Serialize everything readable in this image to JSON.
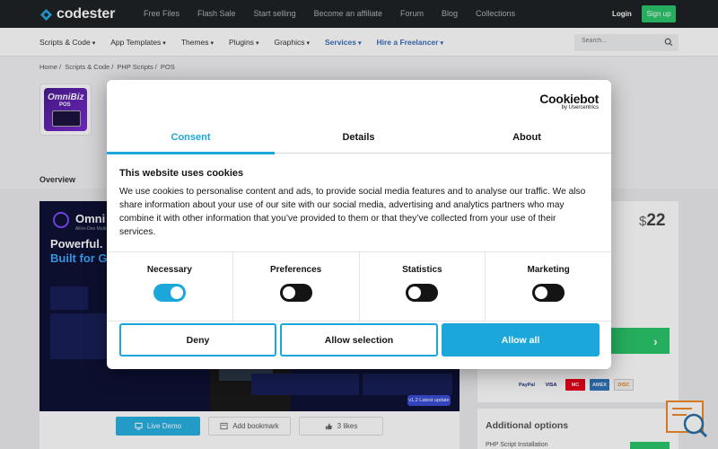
{
  "header": {
    "logo_text": "codester",
    "nav": [
      "Free Files",
      "Flash Sale",
      "Start selling",
      "Become an affiliate",
      "Forum",
      "Blog",
      "Collections"
    ],
    "login": "Login",
    "signup": "Sign up"
  },
  "categories": [
    {
      "label": "Scripts & Code",
      "style": "normal"
    },
    {
      "label": "App Templates",
      "style": "normal"
    },
    {
      "label": "Themes",
      "style": "normal"
    },
    {
      "label": "Plugins",
      "style": "normal"
    },
    {
      "label": "Graphics",
      "style": "normal"
    },
    {
      "label": "Services",
      "style": "blue"
    },
    {
      "label": "Hire a Freelancer",
      "style": "blue"
    }
  ],
  "search": {
    "placeholder": "Search..."
  },
  "breadcrumb": [
    "Home",
    "Scripts & Code",
    "PHP Scripts",
    "POS"
  ],
  "product": {
    "icon_text_1": "OmniBiz",
    "icon_text_2": "POS",
    "tab": "Overview",
    "promo": {
      "name": "Omni",
      "subtitle": "All-in-One Multi-B",
      "headline_1": "Powerful. M",
      "headline_2": "Built for G",
      "version_badge": "v1.2 Latest update"
    },
    "actions": {
      "live_demo": "Live Demo",
      "bookmark": "Add bookmark",
      "likes": "3 likes"
    }
  },
  "sidebar": {
    "currency": "$",
    "price": "22",
    "payments": [
      "PayPal",
      "VISA",
      "MC",
      "AMEX",
      "DISC"
    ],
    "additional_title": "Additional options",
    "additional_row": "PHP Script Installation"
  },
  "cookie": {
    "brand": "Cookiebot",
    "brand_sub": "by Usercentrics",
    "tabs": [
      "Consent",
      "Details",
      "About"
    ],
    "title": "This website uses cookies",
    "text": "We use cookies to personalise content and ads, to provide social media features and to analyse our traffic. We also share information about your use of our site with our social media, advertising and analytics partners who may combine it with other information that you’ve provided to them or that they’ve collected from your use of their services.",
    "toggles": [
      {
        "label": "Necessary",
        "on": true
      },
      {
        "label": "Preferences",
        "on": false
      },
      {
        "label": "Statistics",
        "on": false
      },
      {
        "label": "Marketing",
        "on": false
      }
    ],
    "deny": "Deny",
    "allow_selection": "Allow selection",
    "allow_all": "Allow all"
  },
  "colors": {
    "accent": "#1ba7d9",
    "green": "#2bc76a",
    "topbar": "#1f2326",
    "link_blue": "#3a6fb8"
  }
}
